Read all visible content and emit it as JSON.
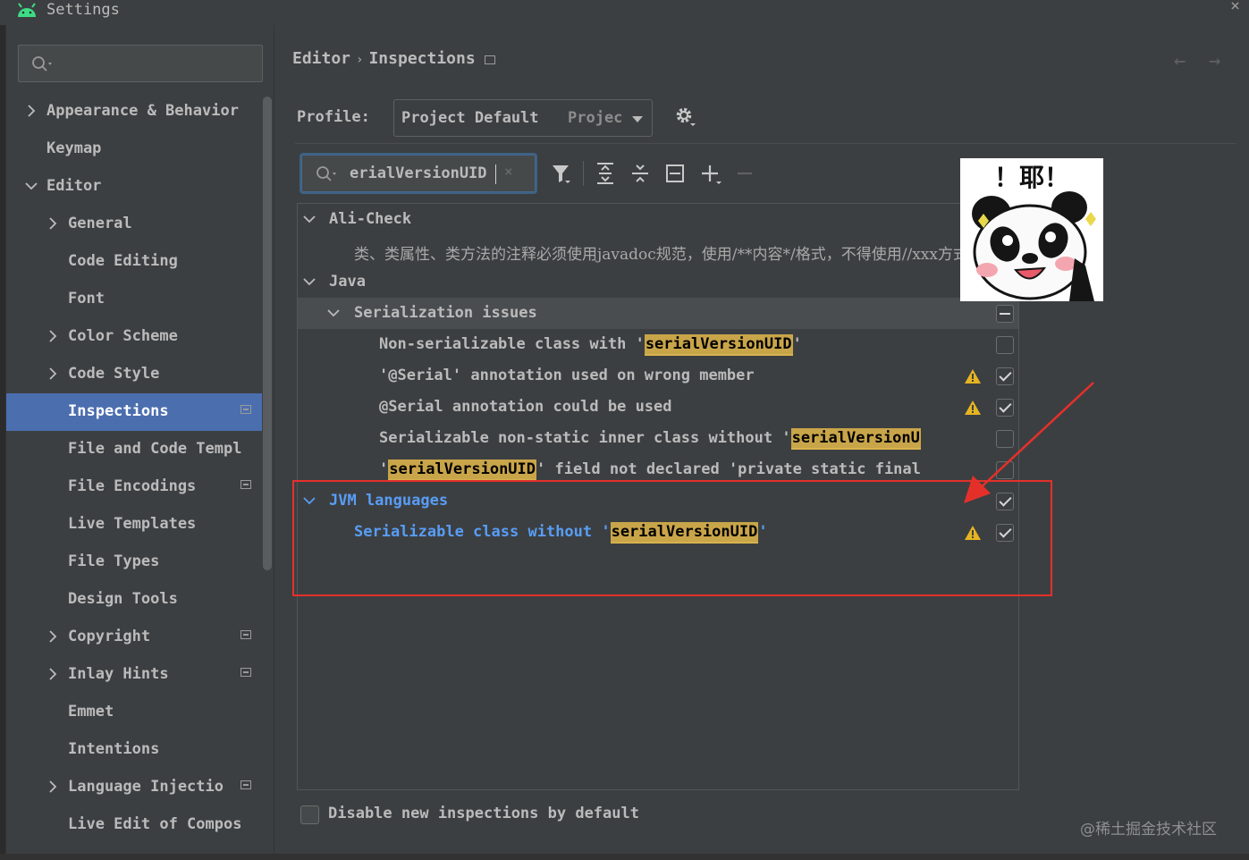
{
  "window": {
    "title": "Settings",
    "close_glyph": "×",
    "app_icon": "android-icon"
  },
  "sidebar": {
    "search_placeholder": "",
    "items": [
      {
        "label": "Appearance & Behavior",
        "level": 0,
        "expandable": true,
        "expanded": false
      },
      {
        "label": "Keymap",
        "level": 0,
        "expandable": false
      },
      {
        "label": "Editor",
        "level": 0,
        "expandable": true,
        "expanded": true
      },
      {
        "label": "General",
        "level": 1,
        "expandable": true,
        "expanded": false
      },
      {
        "label": "Code Editing",
        "level": 1
      },
      {
        "label": "Font",
        "level": 1
      },
      {
        "label": "Color Scheme",
        "level": 1,
        "expandable": true,
        "expanded": false
      },
      {
        "label": "Code Style",
        "level": 1,
        "expandable": true,
        "expanded": false
      },
      {
        "label": "Inspections",
        "level": 1,
        "selected": true,
        "badge": true
      },
      {
        "label": "File and Code Templ",
        "level": 1
      },
      {
        "label": "File Encodings",
        "level": 1,
        "badge": true
      },
      {
        "label": "Live Templates",
        "level": 1
      },
      {
        "label": "File Types",
        "level": 1
      },
      {
        "label": "Design Tools",
        "level": 1
      },
      {
        "label": "Copyright",
        "level": 1,
        "expandable": true,
        "expanded": false,
        "badge": true
      },
      {
        "label": "Inlay Hints",
        "level": 1,
        "expandable": true,
        "expanded": false,
        "badge": true
      },
      {
        "label": "Emmet",
        "level": 1
      },
      {
        "label": "Intentions",
        "level": 1
      },
      {
        "label": "Language Injectio",
        "level": 1,
        "expandable": true,
        "expanded": false,
        "badge": true
      },
      {
        "label": "Live Edit of Compos",
        "level": 1
      }
    ]
  },
  "breadcrumb": {
    "parent": "Editor",
    "separator": "›",
    "current": "Inspections"
  },
  "nav": {
    "back": "←",
    "forward": "→"
  },
  "profile": {
    "label": "Profile:",
    "value": "Project Default",
    "scope": "Projec"
  },
  "filter": {
    "value": "erialVersionUID",
    "clear": "×"
  },
  "tree": {
    "groups": [
      {
        "title": "Ali-Check",
        "description": "类、类属性、类方法的注释必须使用javadoc规范，使用/**内容*/格式，不得使用//xxx方式"
      },
      {
        "title": "Java"
      }
    ],
    "subgroup": {
      "title": "Serialization issues"
    },
    "items": [
      {
        "before": "Non-serializable class with '",
        "match": "serialVersionUID",
        "after": "'",
        "warning": false,
        "checked": false
      },
      {
        "before": "'@Serial' annotation used on wrong member",
        "match": "",
        "after": "",
        "warning": true,
        "checked": true
      },
      {
        "before": "@Serial annotation could be used",
        "match": "",
        "after": "",
        "warning": true,
        "checked": true
      },
      {
        "before": "Serializable non-static inner class without '",
        "match": "serialVersionU",
        "after": "",
        "warning": false,
        "checked": false
      },
      {
        "before": "'",
        "match": "serialVersionUID",
        "after": "' field not declared 'private static final",
        "warning": false,
        "checked": false
      }
    ],
    "jvm": {
      "title": "JVM languages",
      "item": {
        "before": "Serializable class without '",
        "match": "serialVersionUID",
        "after": "'",
        "warning": true,
        "checked": true
      }
    }
  },
  "sticker": {
    "text": "！耶！"
  },
  "footer": {
    "disable_label": "Disable new inspections by default",
    "checked": false
  },
  "watermark": "@稀土掘金技术社区",
  "colors": {
    "selection": "#4b6eaf",
    "highlight": "#c9a54a",
    "jvm_blue": "#589df6",
    "annotation_red": "#e5302a",
    "warning": "#e6b422"
  }
}
